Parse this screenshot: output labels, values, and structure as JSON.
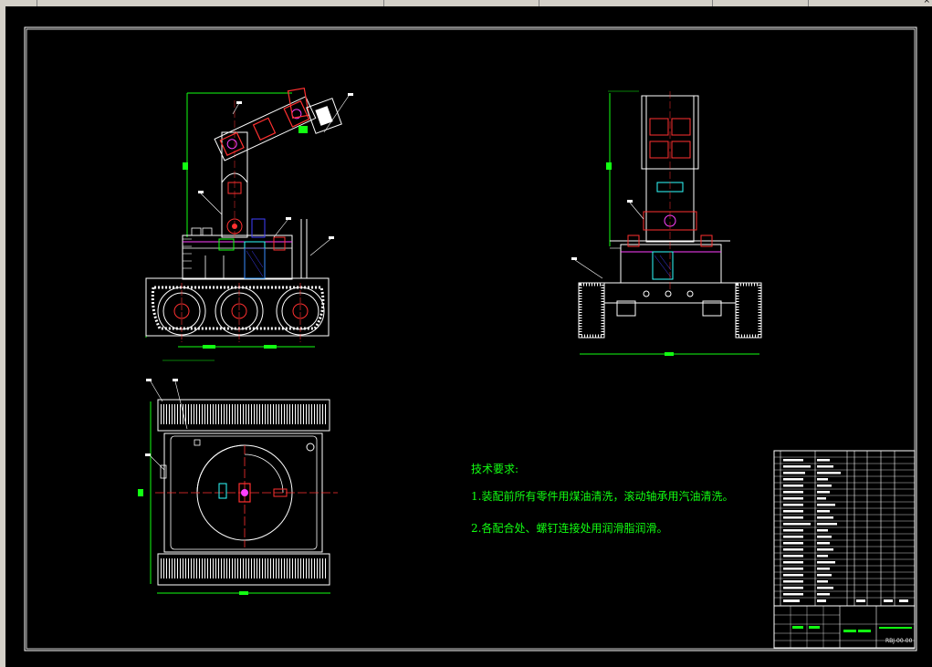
{
  "window": {
    "toolbar_icons": [
      "toolbar-icons"
    ],
    "top_close_glyph": "×"
  },
  "drawing": {
    "tech_requirements": {
      "title": "技术要求:",
      "item1": "1.装配前所有零件用煤油清洗，滚动轴承用汽油清洗。",
      "item2": "2.各配合处、螺钉连接处用润滑脂润滑。"
    },
    "title_block": {
      "drawing_number": "RBJ-00-00"
    },
    "colors": {
      "background": "#000000",
      "lines_white": "#ffffff",
      "dimension_green": "#12ff12",
      "red_parts": "#ff3030",
      "magenta": "#ff40ff",
      "cyan": "#30ffff",
      "blue": "#4040ff",
      "yellow": "#ffff40"
    }
  }
}
